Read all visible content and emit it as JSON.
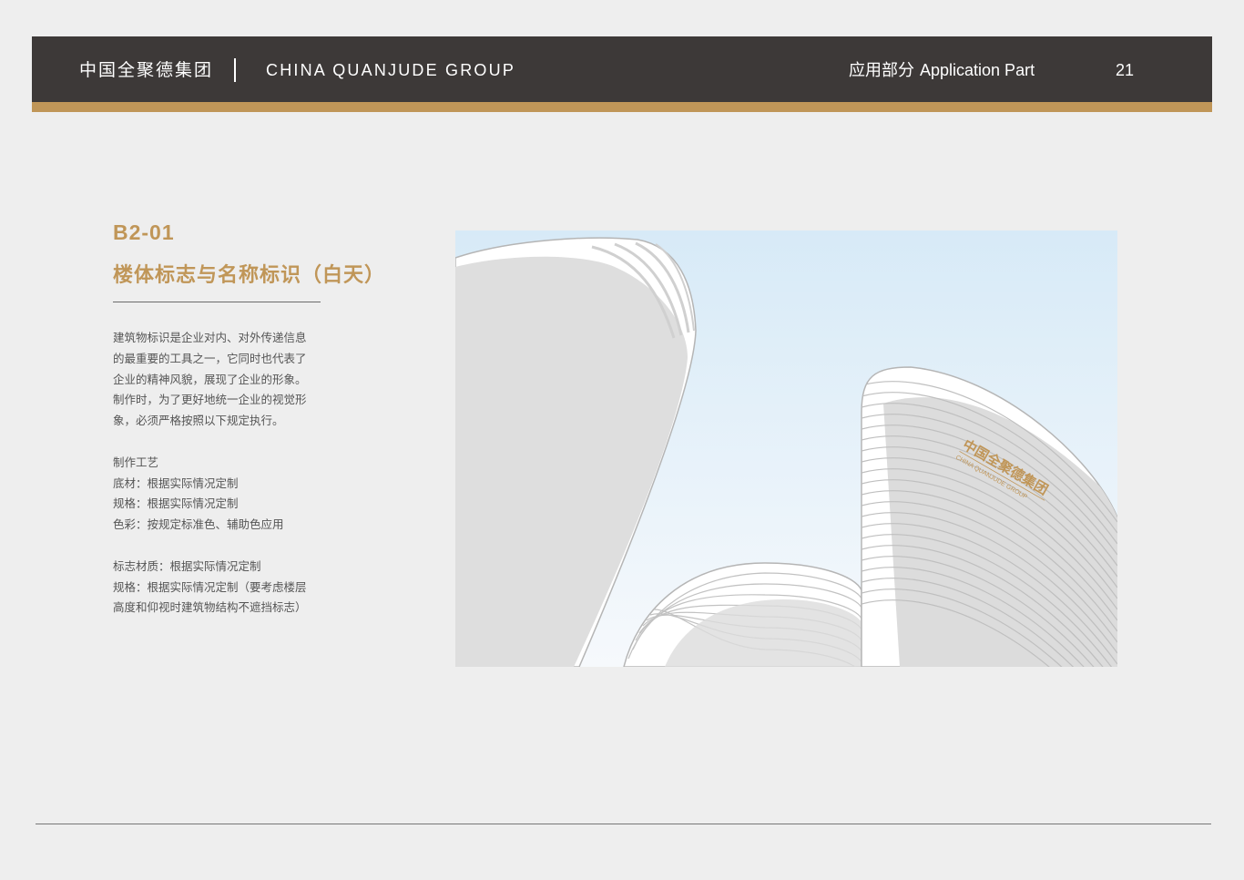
{
  "header": {
    "brand_cn": "中国全聚德集团",
    "brand_en": "CHINA QUANJUDE GROUP",
    "section_cn": "应用部分",
    "section_en": "Application Part",
    "page_number": "21"
  },
  "content": {
    "code": "B2-01",
    "title": "楼体标志与名称标识（白天）",
    "paragraph_lines": [
      "建筑物标识是企业对内、对外传递信息",
      "的最重要的工具之一，它同时也代表了",
      "企业的精神风貌，展现了企业的形象。",
      "制作时，为了更好地统一企业的视觉形",
      "象，必须严格按照以下规定执行。"
    ],
    "craft_heading": "制作工艺",
    "craft_lines": [
      "底材：根据实际情况定制",
      "规格：根据实际情况定制",
      "色彩：按规定标准色、辅助色应用"
    ],
    "material_lines": [
      "标志材质：根据实际情况定制",
      "规格：根据实际情况定制（要考虑楼层",
      "高度和仰视时建筑物结构不遮挡标志）"
    ]
  },
  "illustration": {
    "building_sign_cn": "中国全聚德集团",
    "building_sign_en": "CHINA QUANJUDE GROUP"
  },
  "colors": {
    "header_bg": "#3d3938",
    "accent_gold": "#c09658",
    "page_bg": "#eeeeee",
    "sky_top": "#d7eaf7",
    "sky_bottom": "#f6f9fc"
  }
}
